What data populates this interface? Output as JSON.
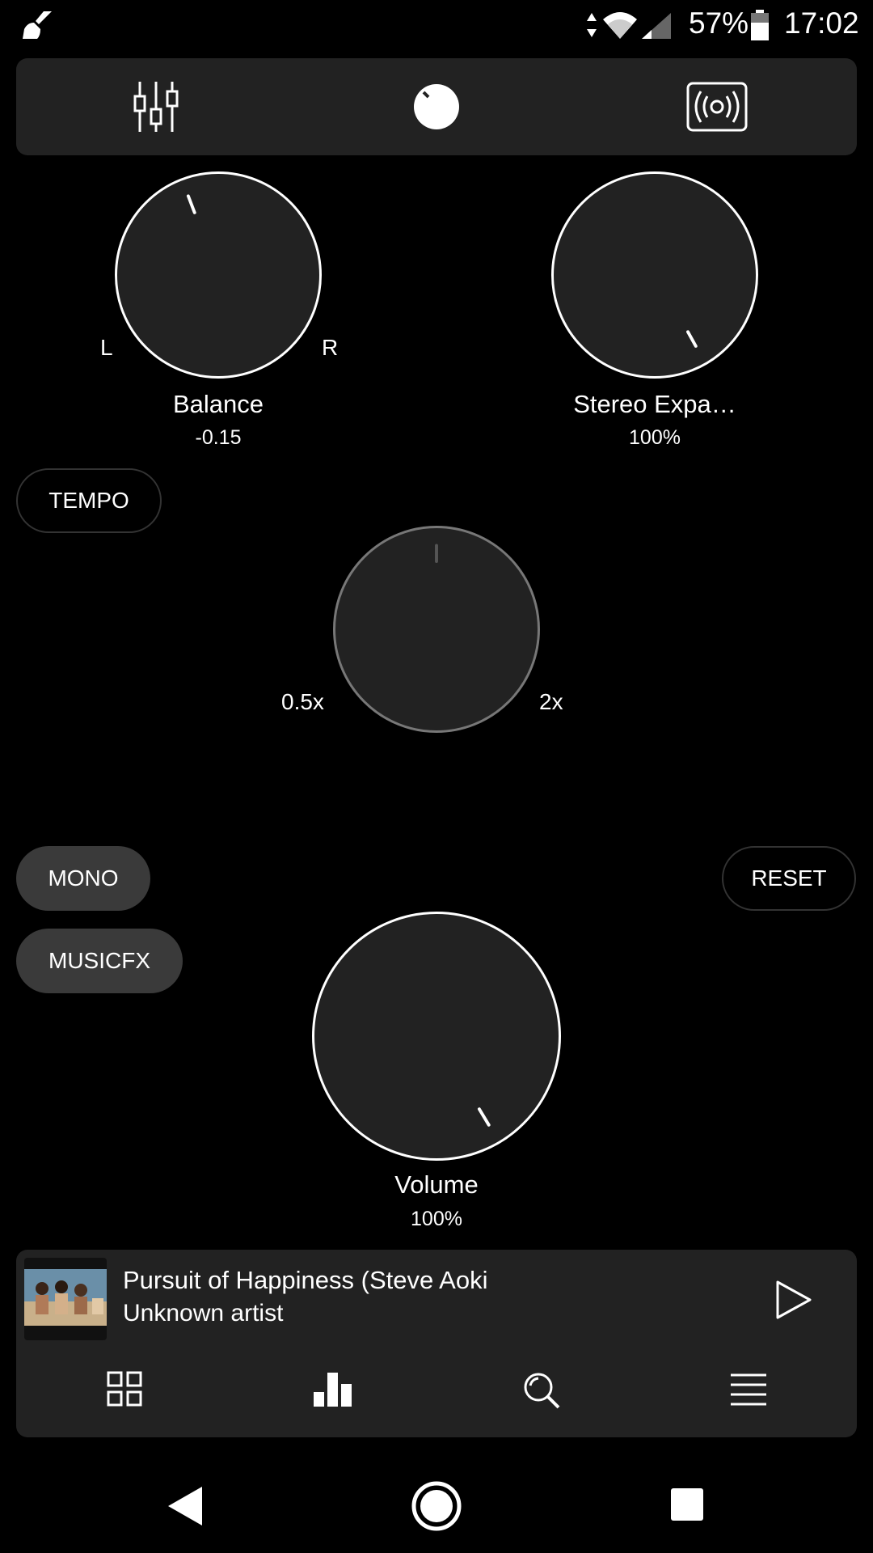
{
  "status_bar": {
    "battery_percent": "57%",
    "time": "17:02",
    "icons": [
      "cleaner-app-icon",
      "data-arrows-icon",
      "wifi-icon",
      "signal-icon",
      "battery-icon"
    ]
  },
  "top_tabs": {
    "items": [
      {
        "name": "equalizer-icon",
        "selected": false
      },
      {
        "name": "knob-icon",
        "selected": true
      },
      {
        "name": "speaker-icon",
        "selected": false
      }
    ]
  },
  "balance": {
    "label": "Balance",
    "value": "-0.15",
    "left_label": "L",
    "right_label": "R"
  },
  "stereo": {
    "label": "Stereo Expa…",
    "value": "100%"
  },
  "tempo": {
    "button_label": "TEMPO",
    "min_label": "0.5x",
    "max_label": "2x"
  },
  "buttons": {
    "mono": "MONO",
    "musicfx": "MUSICFX",
    "reset": "RESET"
  },
  "volume": {
    "label": "Volume",
    "value": "100%"
  },
  "player": {
    "title": "Pursuit of Happiness (Steve Aoki",
    "artist": "Unknown artist",
    "play_icon": "play-icon"
  },
  "bottom_nav": {
    "items": [
      "grid-icon",
      "bar-chart-icon",
      "search-icon",
      "list-icon"
    ]
  },
  "system_nav": {
    "items": [
      "back-icon",
      "home-icon",
      "recents-icon"
    ]
  },
  "colors": {
    "background": "#000000",
    "panel": "#222222",
    "pill_filled": "#3a3a3a",
    "foreground": "#ffffff"
  }
}
